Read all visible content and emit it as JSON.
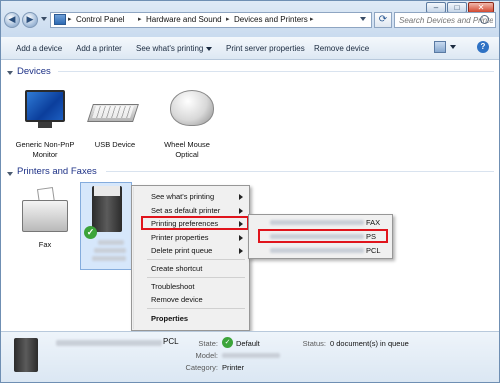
{
  "window": {
    "minimize": "–",
    "maximize": "□",
    "close": "✕"
  },
  "nav": {
    "back_icon": "back-arrow-icon",
    "forward_icon": "forward-arrow-icon"
  },
  "address": {
    "crumbs": [
      "Control Panel",
      "Hardware and Sound",
      "Devices and Printers"
    ],
    "separator": "▸"
  },
  "search": {
    "placeholder": "Search Devices and Printers"
  },
  "toolbar": {
    "add_device": "Add a device",
    "add_printer": "Add a printer",
    "see_printing": "See what's printing",
    "print_server": "Print server properties",
    "remove_device": "Remove device"
  },
  "devices": {
    "title": "Devices",
    "items": [
      {
        "label_line1": "Generic Non-PnP",
        "label_line2": "Monitor"
      },
      {
        "label_line1": "USB Device",
        "label_line2": ""
      },
      {
        "label_line1": "Wheel Mouse",
        "label_line2": "Optical"
      }
    ]
  },
  "printers": {
    "title": "Printers and Faxes",
    "items": [
      {
        "label": "Fax"
      }
    ]
  },
  "context_menu": {
    "items": [
      {
        "label": "See what's printing",
        "submenu": true
      },
      {
        "label": "Set as default printer",
        "submenu": true
      },
      {
        "label": "Printing preferences",
        "submenu": true,
        "highlighted": true
      },
      {
        "label": "Printer properties",
        "submenu": true
      },
      {
        "label": "Delete print queue",
        "submenu": true
      },
      {
        "label": "Create shortcut",
        "submenu": false
      },
      {
        "label": "Troubleshoot",
        "submenu": false
      },
      {
        "label": "Remove device",
        "submenu": false
      },
      {
        "label": "Properties",
        "submenu": false,
        "bold": true
      }
    ]
  },
  "submenu": {
    "items": [
      {
        "suffix": "FAX"
      },
      {
        "suffix": "PS",
        "highlighted": true
      },
      {
        "suffix": "PCL"
      }
    ]
  },
  "details": {
    "name_suffix": "PCL",
    "state_label": "State:",
    "state_value": "Default",
    "model_label": "Model:",
    "category_label": "Category:",
    "category_value": "Printer",
    "status_label": "Status:",
    "status_value": "0 document(s) in queue"
  },
  "colors": {
    "highlight_border": "#e0141c",
    "selection_fill": "#d6e7fb",
    "group_title": "#1e3287"
  }
}
